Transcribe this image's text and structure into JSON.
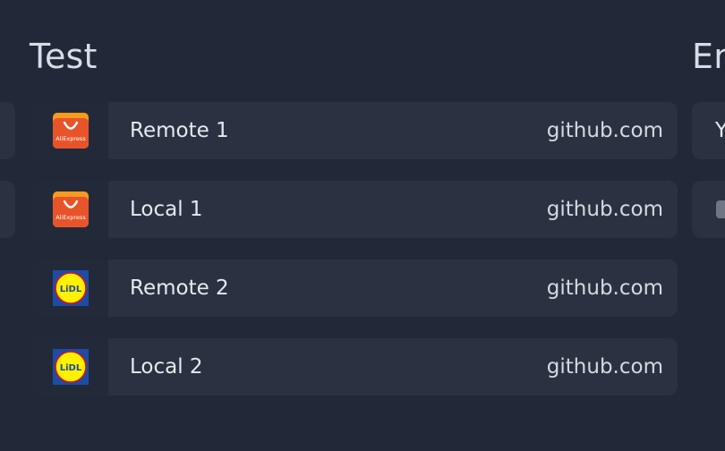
{
  "groups": [
    {
      "title": "Test",
      "items": [
        {
          "name": "Remote 1",
          "url": "github.com",
          "icon": "aliexpress-icon",
          "icon_text": "AliExpress",
          "color": "#e8542a"
        },
        {
          "name": "Local 1",
          "url": "github.com",
          "icon": "aliexpress-icon",
          "icon_text": "AliExpress",
          "color": "#e8542a"
        },
        {
          "name": "Remote 2",
          "url": "github.com",
          "icon": "lidl-icon",
          "icon_text": "LiDL",
          "color": "#1f4ba5"
        },
        {
          "name": "Local 2",
          "url": "github.com",
          "icon": "lidl-icon",
          "icon_text": "LiDL",
          "color": "#1f4ba5"
        }
      ]
    },
    {
      "title": "En",
      "items": [
        {
          "name": "Y"
        },
        {
          "name": ""
        }
      ]
    }
  ],
  "theme": {
    "background": "#212838",
    "card": "#2a3242",
    "icon_box": "#222a39"
  }
}
